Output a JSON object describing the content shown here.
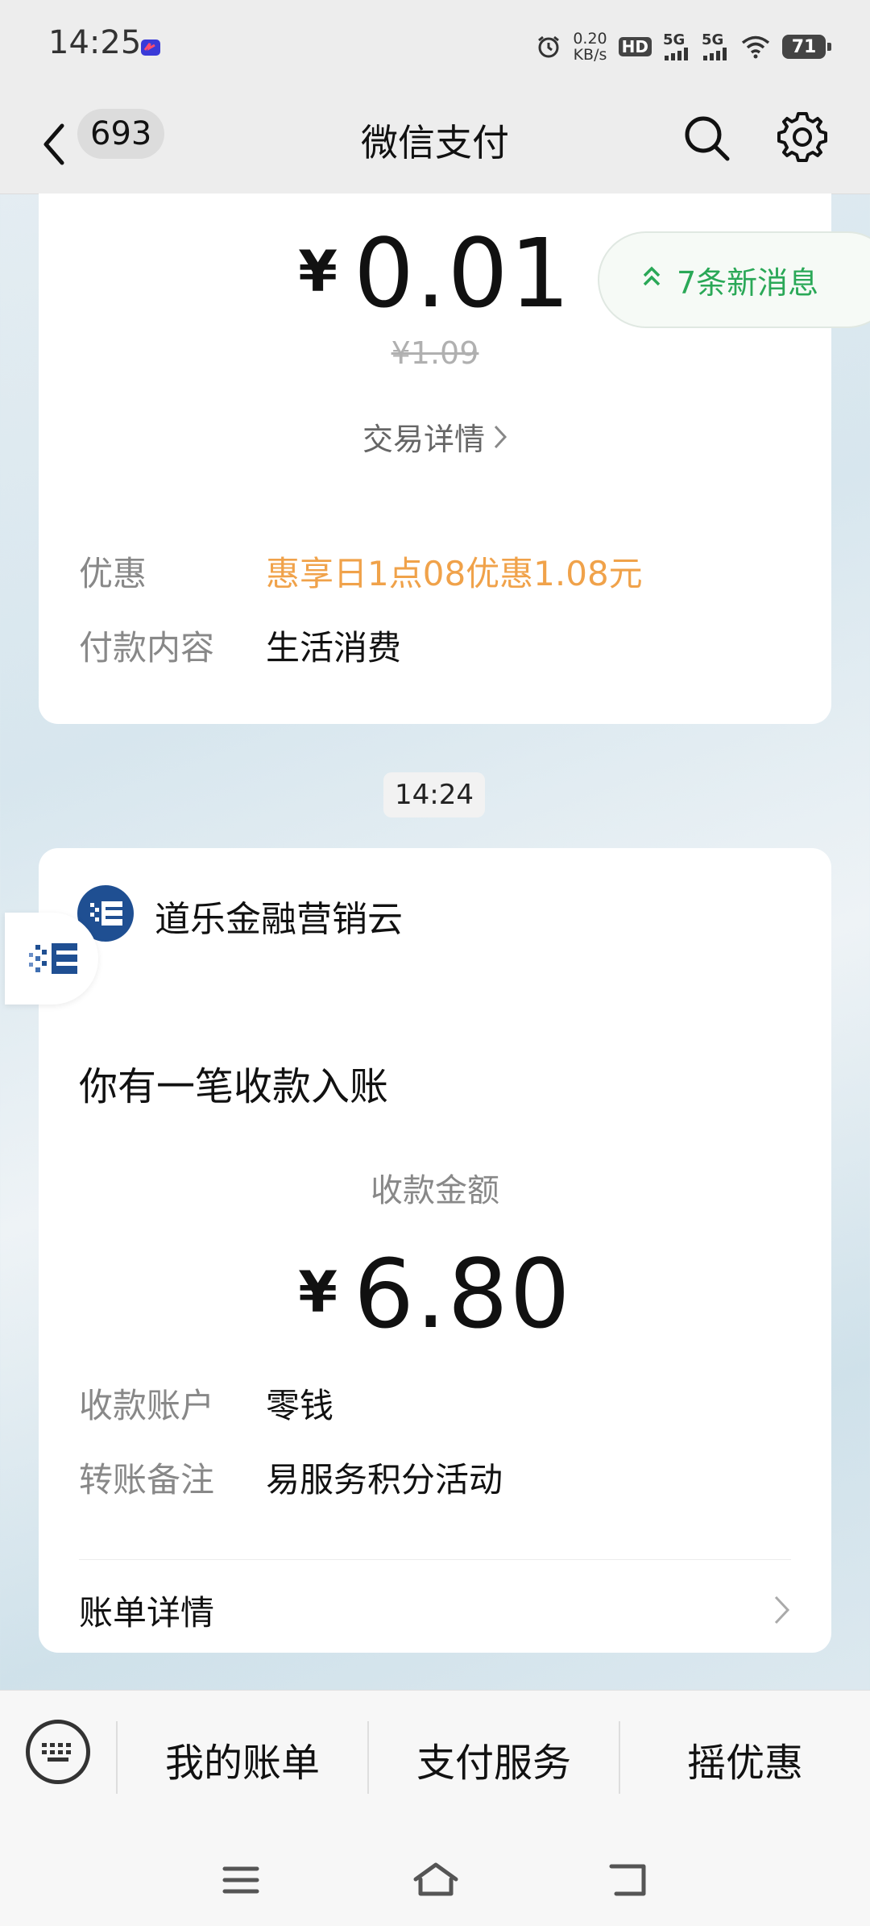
{
  "status_bar": {
    "time": "14:25",
    "speed_value": "0.20",
    "speed_unit": "KB/s",
    "hd_label": "HD",
    "sim1_label": "5G",
    "sim2_label": "5G",
    "battery": "71"
  },
  "nav": {
    "unread_count": "693",
    "title": "微信支付"
  },
  "float_banner": {
    "text": "7条新消息"
  },
  "payment_card": {
    "currency": "¥",
    "amount": "0.01",
    "original_price": "¥1.09",
    "detail_link": "交易详情",
    "rows": [
      {
        "label": "优惠",
        "value": "惠享日1点08优惠1.08元"
      },
      {
        "label": "付款内容",
        "value": "生活消费"
      }
    ]
  },
  "timestamp": "14:24",
  "receipt_card": {
    "merchant": "道乐金融营销云",
    "title": "你有一笔收款入账",
    "amount_label": "收款金额",
    "currency": "¥",
    "amount": "6.80",
    "rows": [
      {
        "label": "收款账户",
        "value": "零钱"
      },
      {
        "label": "转账备注",
        "value": "易服务积分活动"
      }
    ],
    "bill_detail": "账单详情"
  },
  "bottom_menu": {
    "items": [
      "我的账单",
      "支付服务",
      "摇优惠"
    ]
  },
  "colors": {
    "accent_green": "#2aa857",
    "discount_orange": "#f0a24a",
    "merchant_blue": "#1f4f92"
  }
}
